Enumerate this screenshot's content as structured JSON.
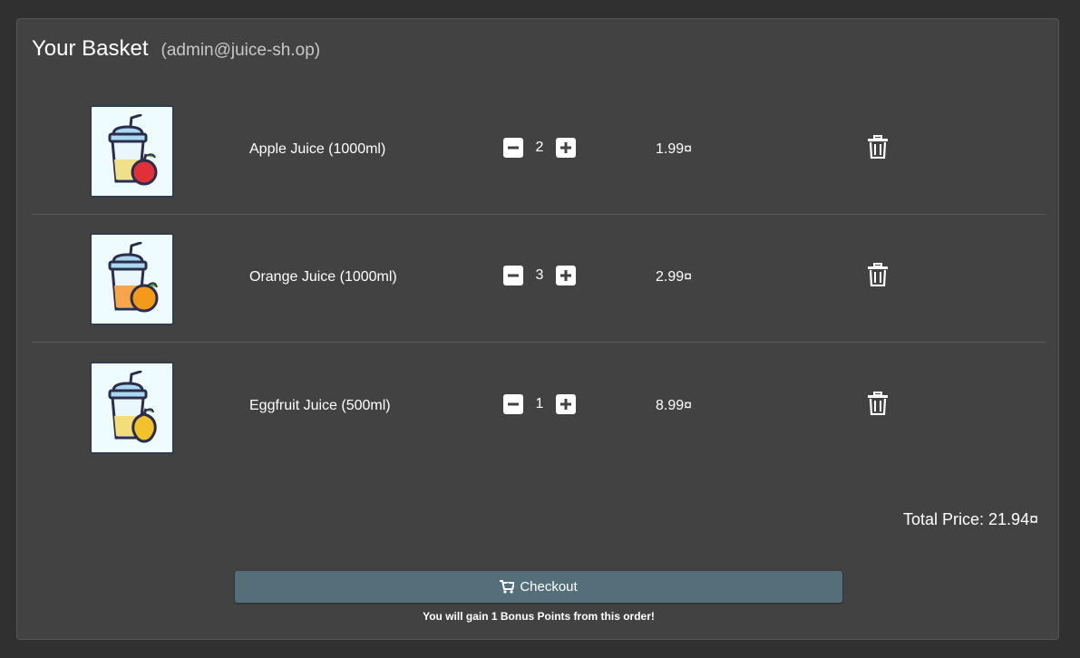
{
  "basket": {
    "title": "Your Basket",
    "user": "(admin@juice-sh.op)"
  },
  "items": [
    {
      "name": "Apple Juice (1000ml)",
      "quantity": "2",
      "price": "1.99¤",
      "fruit_color": "#e0303a",
      "icon": "apple-juice-image"
    },
    {
      "name": "Orange Juice (1000ml)",
      "quantity": "3",
      "price": "2.99¤",
      "fruit_color": "#f49a1a",
      "icon": "orange-juice-image"
    },
    {
      "name": "Eggfruit Juice (500ml)",
      "quantity": "1",
      "price": "8.99¤",
      "fruit_color": "#f2c12e",
      "icon": "eggfruit-juice-image"
    }
  ],
  "summary": {
    "total": "Total Price: 21.94¤",
    "checkout_label": "Checkout",
    "bonus_text": "You will gain 1 Bonus Points from this order!"
  },
  "colors": {
    "background": "#303030",
    "card": "#424242",
    "checkout_button": "#546e7a"
  }
}
